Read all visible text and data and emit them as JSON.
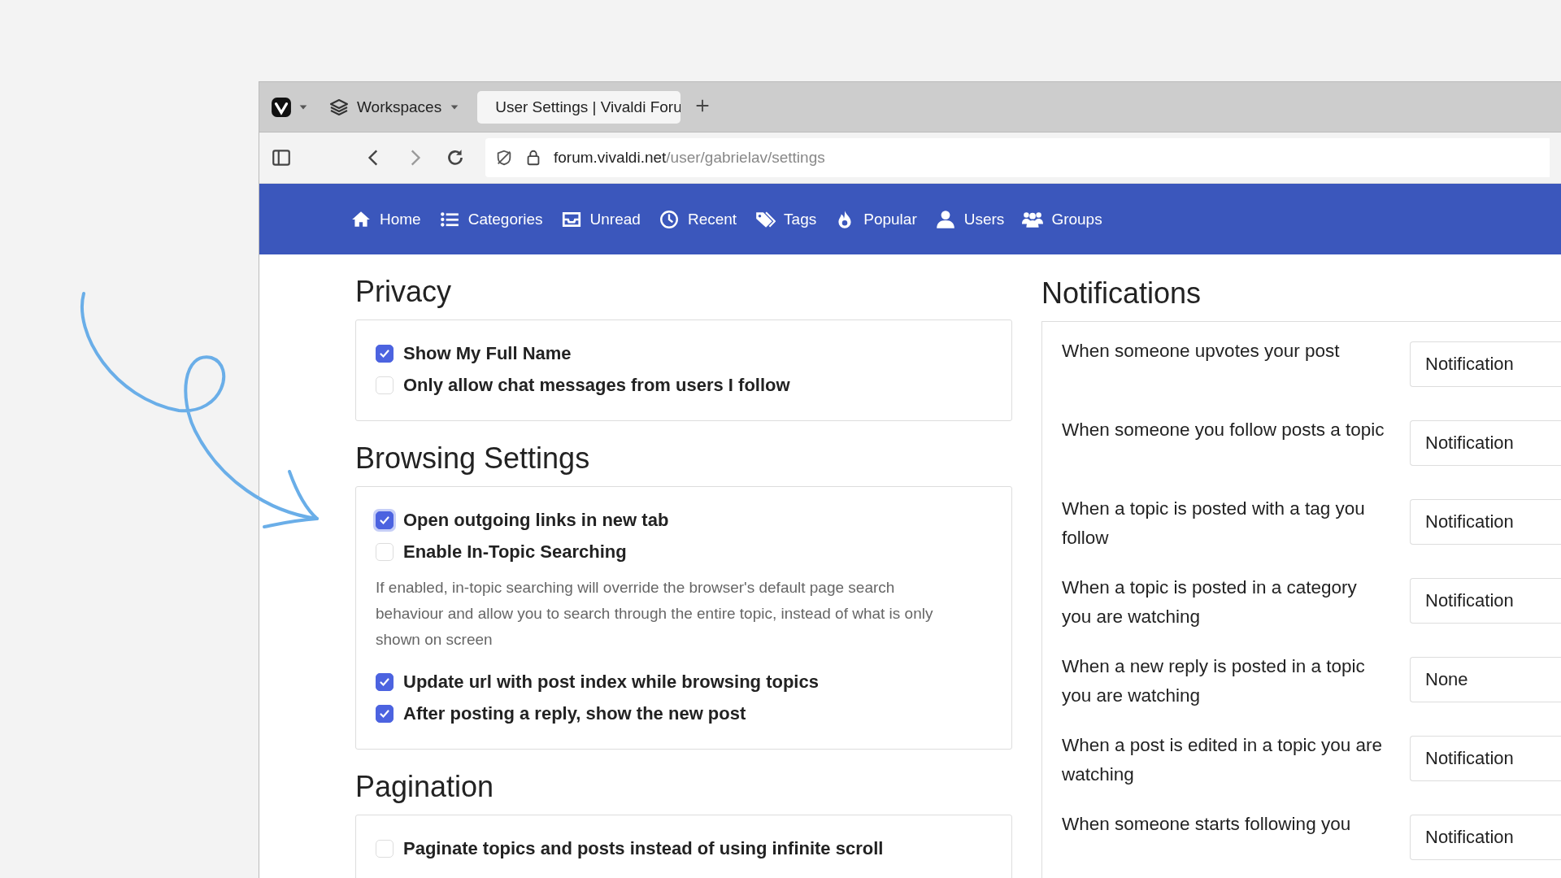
{
  "browser": {
    "tabs": [
      {
        "kind": "workspaces",
        "label": "Workspaces",
        "selected": false
      },
      {
        "kind": "page",
        "label": "User Settings | Vivaldi Foru",
        "selected": true
      }
    ],
    "address": {
      "host": "forum.vivaldi.net",
      "path": "/user/gabrielav/settings"
    }
  },
  "nav": [
    {
      "label": "Home"
    },
    {
      "label": "Categories"
    },
    {
      "label": "Unread"
    },
    {
      "label": "Recent"
    },
    {
      "label": "Tags"
    },
    {
      "label": "Popular"
    },
    {
      "label": "Users"
    },
    {
      "label": "Groups"
    }
  ],
  "sections": [
    {
      "title": "Privacy",
      "items": [
        {
          "kind": "checkbox",
          "label": "Show My Full Name",
          "checked": true,
          "focused": false
        },
        {
          "kind": "checkbox",
          "label": "Only allow chat messages from users I follow",
          "checked": false,
          "focused": false
        }
      ]
    },
    {
      "title": "Browsing Settings",
      "items": [
        {
          "kind": "checkbox",
          "label": "Open outgoing links in new tab",
          "checked": true,
          "focused": true
        },
        {
          "kind": "checkbox",
          "label": "Enable In-Topic Searching",
          "checked": false,
          "focused": false
        },
        {
          "kind": "help",
          "text": "If enabled, in-topic searching will override the browser's default page search behaviour and allow you to search through the entire topic, instead of what is only shown on screen"
        },
        {
          "kind": "checkbox",
          "label": "Update url with post index while browsing topics",
          "checked": true,
          "focused": false
        },
        {
          "kind": "checkbox",
          "label": "After posting a reply, show the new post",
          "checked": true,
          "focused": false
        }
      ]
    },
    {
      "title": "Pagination",
      "items": [
        {
          "kind": "checkbox",
          "label": "Paginate topics and posts instead of using infinite scroll",
          "checked": false,
          "focused": false
        }
      ]
    }
  ],
  "notifications": {
    "title": "Notifications",
    "rows": [
      {
        "label": "When someone upvotes your post",
        "value": "Notification"
      },
      {
        "label": "When someone you follow posts a topic",
        "value": "Notification"
      },
      {
        "label": "When a topic is posted with a tag you follow",
        "value": "Notification"
      },
      {
        "label": "When a topic is posted in a category you are watching",
        "value": "Notification"
      },
      {
        "label": "When a new reply is posted in a topic you are watching",
        "value": "None"
      },
      {
        "label": "When a post is edited in a topic you are watching",
        "value": "Notification"
      },
      {
        "label": "When someone starts following you",
        "value": "Notification"
      }
    ]
  }
}
